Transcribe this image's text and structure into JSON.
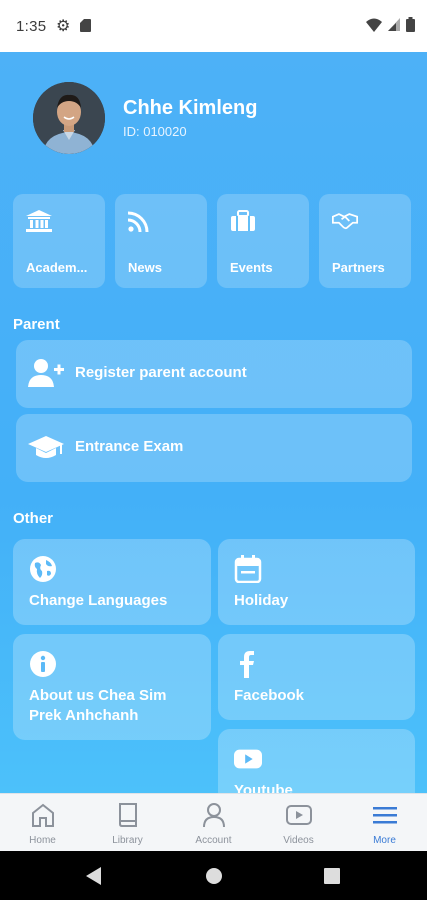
{
  "status_bar": {
    "time": "1:35"
  },
  "profile": {
    "name": "Chhe Kimleng",
    "id_text": "ID: 010020"
  },
  "quick_tiles": [
    {
      "label": "Academ...",
      "icon": "bank-icon"
    },
    {
      "label": "News",
      "icon": "rss-icon"
    },
    {
      "label": "Events",
      "icon": "briefcase-icon"
    },
    {
      "label": "Partners",
      "icon": "handshake-icon"
    }
  ],
  "parent": {
    "title": "Parent",
    "items": [
      {
        "label": "Register parent account",
        "icon": "user-plus-icon"
      },
      {
        "label": "Entrance Exam",
        "icon": "graduation-cap-icon"
      }
    ]
  },
  "other": {
    "title": "Other",
    "items": [
      {
        "label": "Change Languages",
        "icon": "globe-icon"
      },
      {
        "label": "Holiday",
        "icon": "calendar-icon"
      },
      {
        "label": "About us Chea Sim Prek Anhchanh",
        "icon": "info-icon"
      },
      {
        "label": "Facebook",
        "icon": "facebook-icon"
      },
      {
        "label": "Youtube",
        "icon": "youtube-icon"
      }
    ]
  },
  "bottom_nav": [
    {
      "label": "Home",
      "icon": "home-icon"
    },
    {
      "label": "Library",
      "icon": "book-icon"
    },
    {
      "label": "Account",
      "icon": "user-icon"
    },
    {
      "label": "Videos",
      "icon": "play-icon"
    },
    {
      "label": "More",
      "icon": "menu-icon",
      "active": true
    }
  ],
  "colors": {
    "background": "#43b0f8",
    "active_nav": "#3a7bd5"
  }
}
